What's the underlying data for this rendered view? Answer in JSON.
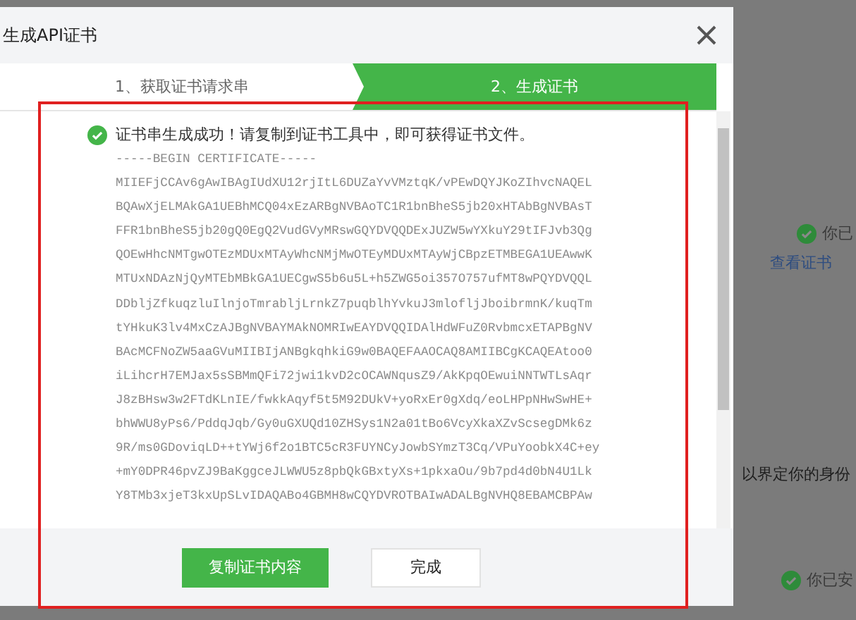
{
  "background": {
    "items": [
      {
        "kind": "status",
        "text": "你已"
      },
      {
        "kind": "link",
        "text": "查看证书"
      },
      {
        "kind": "text",
        "text": "以界定你的身份"
      },
      {
        "kind": "status",
        "text": "你已安"
      }
    ]
  },
  "dialog": {
    "title": "生成API证书",
    "steps": [
      {
        "label": "1、获取证书请求串",
        "selected": false
      },
      {
        "label": "2、生成证书",
        "selected": true
      }
    ],
    "message": "证书串生成成功！请复制到证书工具中，即可获得证书文件。",
    "certificate_lines": [
      "-----BEGIN CERTIFICATE-----",
      "MIIEFjCCAv6gAwIBAgIUdXU12rjItL6DUZaYvVMztqK/vPEwDQYJKoZIhvcNAQEL",
      "BQAwXjELMAkGA1UEBhMCQ04xEzARBgNVBAoTC1R1bnBheS5jb20xHTAbBgNVBAsT",
      "FFR1bnBheS5jb20gQ0EgQ2VudGVyMRswGQYDVQQDExJUZW5wYXkuY29tIFJvb3Qg",
      "QOEwHhcNMTgwOTEzMDUxMTAyWhcNMjMwOTEyMDUxMTAyWjCBpzETMBEGA1UEAwwK",
      "MTUxNDAzNjQyMTEbMBkGA1UECgwS5b6u5L+h5ZWG5oi357O757ufMT8wPQYDVQQL",
      "DDbljZfkuqzluIlnjoTmrabljLrnkZ7puqblhYvkuJ3mlofljJboibrmnK/kuqTm",
      "tYHkuK3lv4MxCzAJBgNVBAYMAkNOMRIwEAYDVQQIDAlHdWFuZ0RvbmcxETAPBgNV",
      "BAcMCFNoZW5aaGVuMIIBIjANBgkqhkiG9w0BAQEFAAOCAQ8AMIIBCgKCAQEAtoo0",
      "iLihcrH7EMJax5sSBMmQFi72jwi1kvD2cOCAWNqusZ9/AkKpqOEwuiNNTWTLsAqr",
      "J8zBHsw3w2FTdKLnIE/fwkkAqyf5t5M92DUkV+yoRxEr0gXdq/eoLHPpNHwSwHE+",
      "bhWWU8yPs6/PddqJqb/Gy0uGXUQd10ZHSys1N2a01tBo6VcyXkaXZvScsegDMk6z",
      "9R/ms0GDoviqLD++tYWj6f2o1BTC5cR3FUYNCyJowbSYmzT3Cq/VPuYoobkX4C+ey",
      "+mY0DPR46pvZJ9BaKggceJLWWU5z8pbQkGBxtyXs+1pkxaOu/9b7pd4d0bN4U1Lk",
      "Y8TMb3xjeT3kxUpSLvIDAQABo4GBMH8wCQYDVROTBAIwADALBgNVHQ8EBAMCBPAw"
    ],
    "buttons": [
      {
        "label": "复制证书内容",
        "kind": "primary"
      },
      {
        "label": "完成",
        "kind": "default"
      }
    ]
  }
}
